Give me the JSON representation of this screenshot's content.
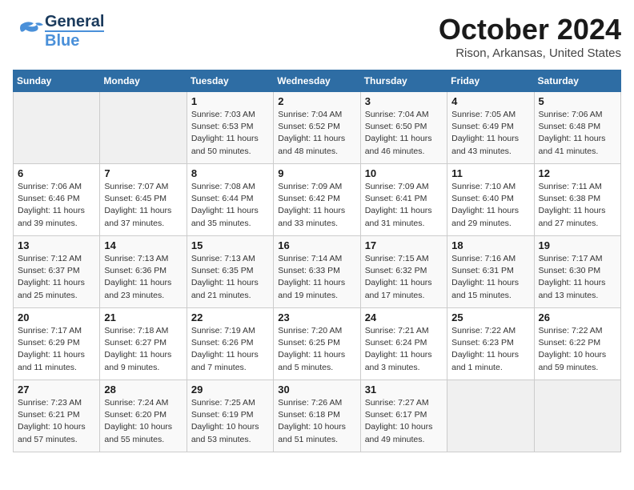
{
  "header": {
    "logo_line1": "General",
    "logo_line2": "Blue",
    "month": "October 2024",
    "location": "Rison, Arkansas, United States"
  },
  "weekdays": [
    "Sunday",
    "Monday",
    "Tuesday",
    "Wednesday",
    "Thursday",
    "Friday",
    "Saturday"
  ],
  "weeks": [
    [
      {
        "day": "",
        "info": ""
      },
      {
        "day": "",
        "info": ""
      },
      {
        "day": "1",
        "sunrise": "7:03 AM",
        "sunset": "6:53 PM",
        "daylight": "11 hours and 50 minutes."
      },
      {
        "day": "2",
        "sunrise": "7:04 AM",
        "sunset": "6:52 PM",
        "daylight": "11 hours and 48 minutes."
      },
      {
        "day": "3",
        "sunrise": "7:04 AM",
        "sunset": "6:50 PM",
        "daylight": "11 hours and 46 minutes."
      },
      {
        "day": "4",
        "sunrise": "7:05 AM",
        "sunset": "6:49 PM",
        "daylight": "11 hours and 43 minutes."
      },
      {
        "day": "5",
        "sunrise": "7:06 AM",
        "sunset": "6:48 PM",
        "daylight": "11 hours and 41 minutes."
      }
    ],
    [
      {
        "day": "6",
        "sunrise": "7:06 AM",
        "sunset": "6:46 PM",
        "daylight": "11 hours and 39 minutes."
      },
      {
        "day": "7",
        "sunrise": "7:07 AM",
        "sunset": "6:45 PM",
        "daylight": "11 hours and 37 minutes."
      },
      {
        "day": "8",
        "sunrise": "7:08 AM",
        "sunset": "6:44 PM",
        "daylight": "11 hours and 35 minutes."
      },
      {
        "day": "9",
        "sunrise": "7:09 AM",
        "sunset": "6:42 PM",
        "daylight": "11 hours and 33 minutes."
      },
      {
        "day": "10",
        "sunrise": "7:09 AM",
        "sunset": "6:41 PM",
        "daylight": "11 hours and 31 minutes."
      },
      {
        "day": "11",
        "sunrise": "7:10 AM",
        "sunset": "6:40 PM",
        "daylight": "11 hours and 29 minutes."
      },
      {
        "day": "12",
        "sunrise": "7:11 AM",
        "sunset": "6:38 PM",
        "daylight": "11 hours and 27 minutes."
      }
    ],
    [
      {
        "day": "13",
        "sunrise": "7:12 AM",
        "sunset": "6:37 PM",
        "daylight": "11 hours and 25 minutes."
      },
      {
        "day": "14",
        "sunrise": "7:13 AM",
        "sunset": "6:36 PM",
        "daylight": "11 hours and 23 minutes."
      },
      {
        "day": "15",
        "sunrise": "7:13 AM",
        "sunset": "6:35 PM",
        "daylight": "11 hours and 21 minutes."
      },
      {
        "day": "16",
        "sunrise": "7:14 AM",
        "sunset": "6:33 PM",
        "daylight": "11 hours and 19 minutes."
      },
      {
        "day": "17",
        "sunrise": "7:15 AM",
        "sunset": "6:32 PM",
        "daylight": "11 hours and 17 minutes."
      },
      {
        "day": "18",
        "sunrise": "7:16 AM",
        "sunset": "6:31 PM",
        "daylight": "11 hours and 15 minutes."
      },
      {
        "day": "19",
        "sunrise": "7:17 AM",
        "sunset": "6:30 PM",
        "daylight": "11 hours and 13 minutes."
      }
    ],
    [
      {
        "day": "20",
        "sunrise": "7:17 AM",
        "sunset": "6:29 PM",
        "daylight": "11 hours and 11 minutes."
      },
      {
        "day": "21",
        "sunrise": "7:18 AM",
        "sunset": "6:27 PM",
        "daylight": "11 hours and 9 minutes."
      },
      {
        "day": "22",
        "sunrise": "7:19 AM",
        "sunset": "6:26 PM",
        "daylight": "11 hours and 7 minutes."
      },
      {
        "day": "23",
        "sunrise": "7:20 AM",
        "sunset": "6:25 PM",
        "daylight": "11 hours and 5 minutes."
      },
      {
        "day": "24",
        "sunrise": "7:21 AM",
        "sunset": "6:24 PM",
        "daylight": "11 hours and 3 minutes."
      },
      {
        "day": "25",
        "sunrise": "7:22 AM",
        "sunset": "6:23 PM",
        "daylight": "11 hours and 1 minute."
      },
      {
        "day": "26",
        "sunrise": "7:22 AM",
        "sunset": "6:22 PM",
        "daylight": "10 hours and 59 minutes."
      }
    ],
    [
      {
        "day": "27",
        "sunrise": "7:23 AM",
        "sunset": "6:21 PM",
        "daylight": "10 hours and 57 minutes."
      },
      {
        "day": "28",
        "sunrise": "7:24 AM",
        "sunset": "6:20 PM",
        "daylight": "10 hours and 55 minutes."
      },
      {
        "day": "29",
        "sunrise": "7:25 AM",
        "sunset": "6:19 PM",
        "daylight": "10 hours and 53 minutes."
      },
      {
        "day": "30",
        "sunrise": "7:26 AM",
        "sunset": "6:18 PM",
        "daylight": "10 hours and 51 minutes."
      },
      {
        "day": "31",
        "sunrise": "7:27 AM",
        "sunset": "6:17 PM",
        "daylight": "10 hours and 49 minutes."
      },
      {
        "day": "",
        "info": ""
      },
      {
        "day": "",
        "info": ""
      }
    ]
  ],
  "labels": {
    "sunrise": "Sunrise:",
    "sunset": "Sunset:",
    "daylight": "Daylight:"
  }
}
